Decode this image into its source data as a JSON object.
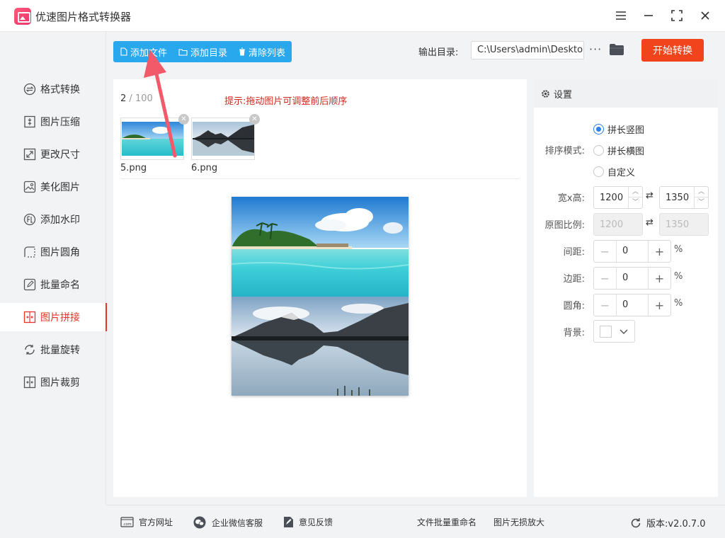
{
  "app": {
    "title": "优速图片格式转换器"
  },
  "sidebar": {
    "items": [
      {
        "label": "格式转换",
        "icon": "format-convert-icon"
      },
      {
        "label": "图片压缩",
        "icon": "compress-icon"
      },
      {
        "label": "更改尺寸",
        "icon": "resize-icon"
      },
      {
        "label": "美化图片",
        "icon": "beautify-icon"
      },
      {
        "label": "添加水印",
        "icon": "watermark-icon"
      },
      {
        "label": "图片圆角",
        "icon": "round-corner-icon"
      },
      {
        "label": "批量命名",
        "icon": "rename-icon"
      },
      {
        "label": "图片拼接",
        "icon": "splice-icon"
      },
      {
        "label": "批量旋转",
        "icon": "rotate-icon"
      },
      {
        "label": "图片裁剪",
        "icon": "crop-icon"
      }
    ],
    "active_index": 7
  },
  "toolbar": {
    "add_file": "添加文件",
    "add_folder": "添加目录",
    "clear_list": "清除列表",
    "output_label": "输出目录:",
    "output_path": "C:\\Users\\admin\\Deskto",
    "more": "···",
    "start": "开始转换"
  },
  "list": {
    "count": "2",
    "separator": "/",
    "max": "100",
    "hint": "提示:拖动图片可调整前后顺序",
    "files": [
      {
        "name": "5.png"
      },
      {
        "name": "6.png"
      }
    ]
  },
  "settings": {
    "title": "设置",
    "sort_label": "排序模式:",
    "sort_options": [
      "拼长竖图",
      "拼长横图",
      "自定义"
    ],
    "sort_selected": "拼长竖图",
    "size_label": "宽x高:",
    "width": "1200",
    "height": "1350",
    "ratio_label": "原图比例:",
    "ratio_width": "1200",
    "ratio_height": "1350",
    "spacing_label": "间距:",
    "spacing": "0",
    "margin_label": "边距:",
    "margin": "0",
    "radius_label": "圆角:",
    "radius": "0",
    "percent": "%",
    "background_label": "背景:",
    "background_color": "#ffffff"
  },
  "footer": {
    "website": "官方网址",
    "wechat": "企业微信客服",
    "feedback": "意见反馈",
    "batch_rename": "文件批量重命名",
    "lossless_zoom": "图片无损放大",
    "version": "版本:v2.0.7.0"
  },
  "colors": {
    "accent_blue": "#2aa8ee",
    "start_button": "#f2441c",
    "active_nav": "#e5352b",
    "hint": "#d4261c",
    "radio": "#2f7fe8"
  }
}
